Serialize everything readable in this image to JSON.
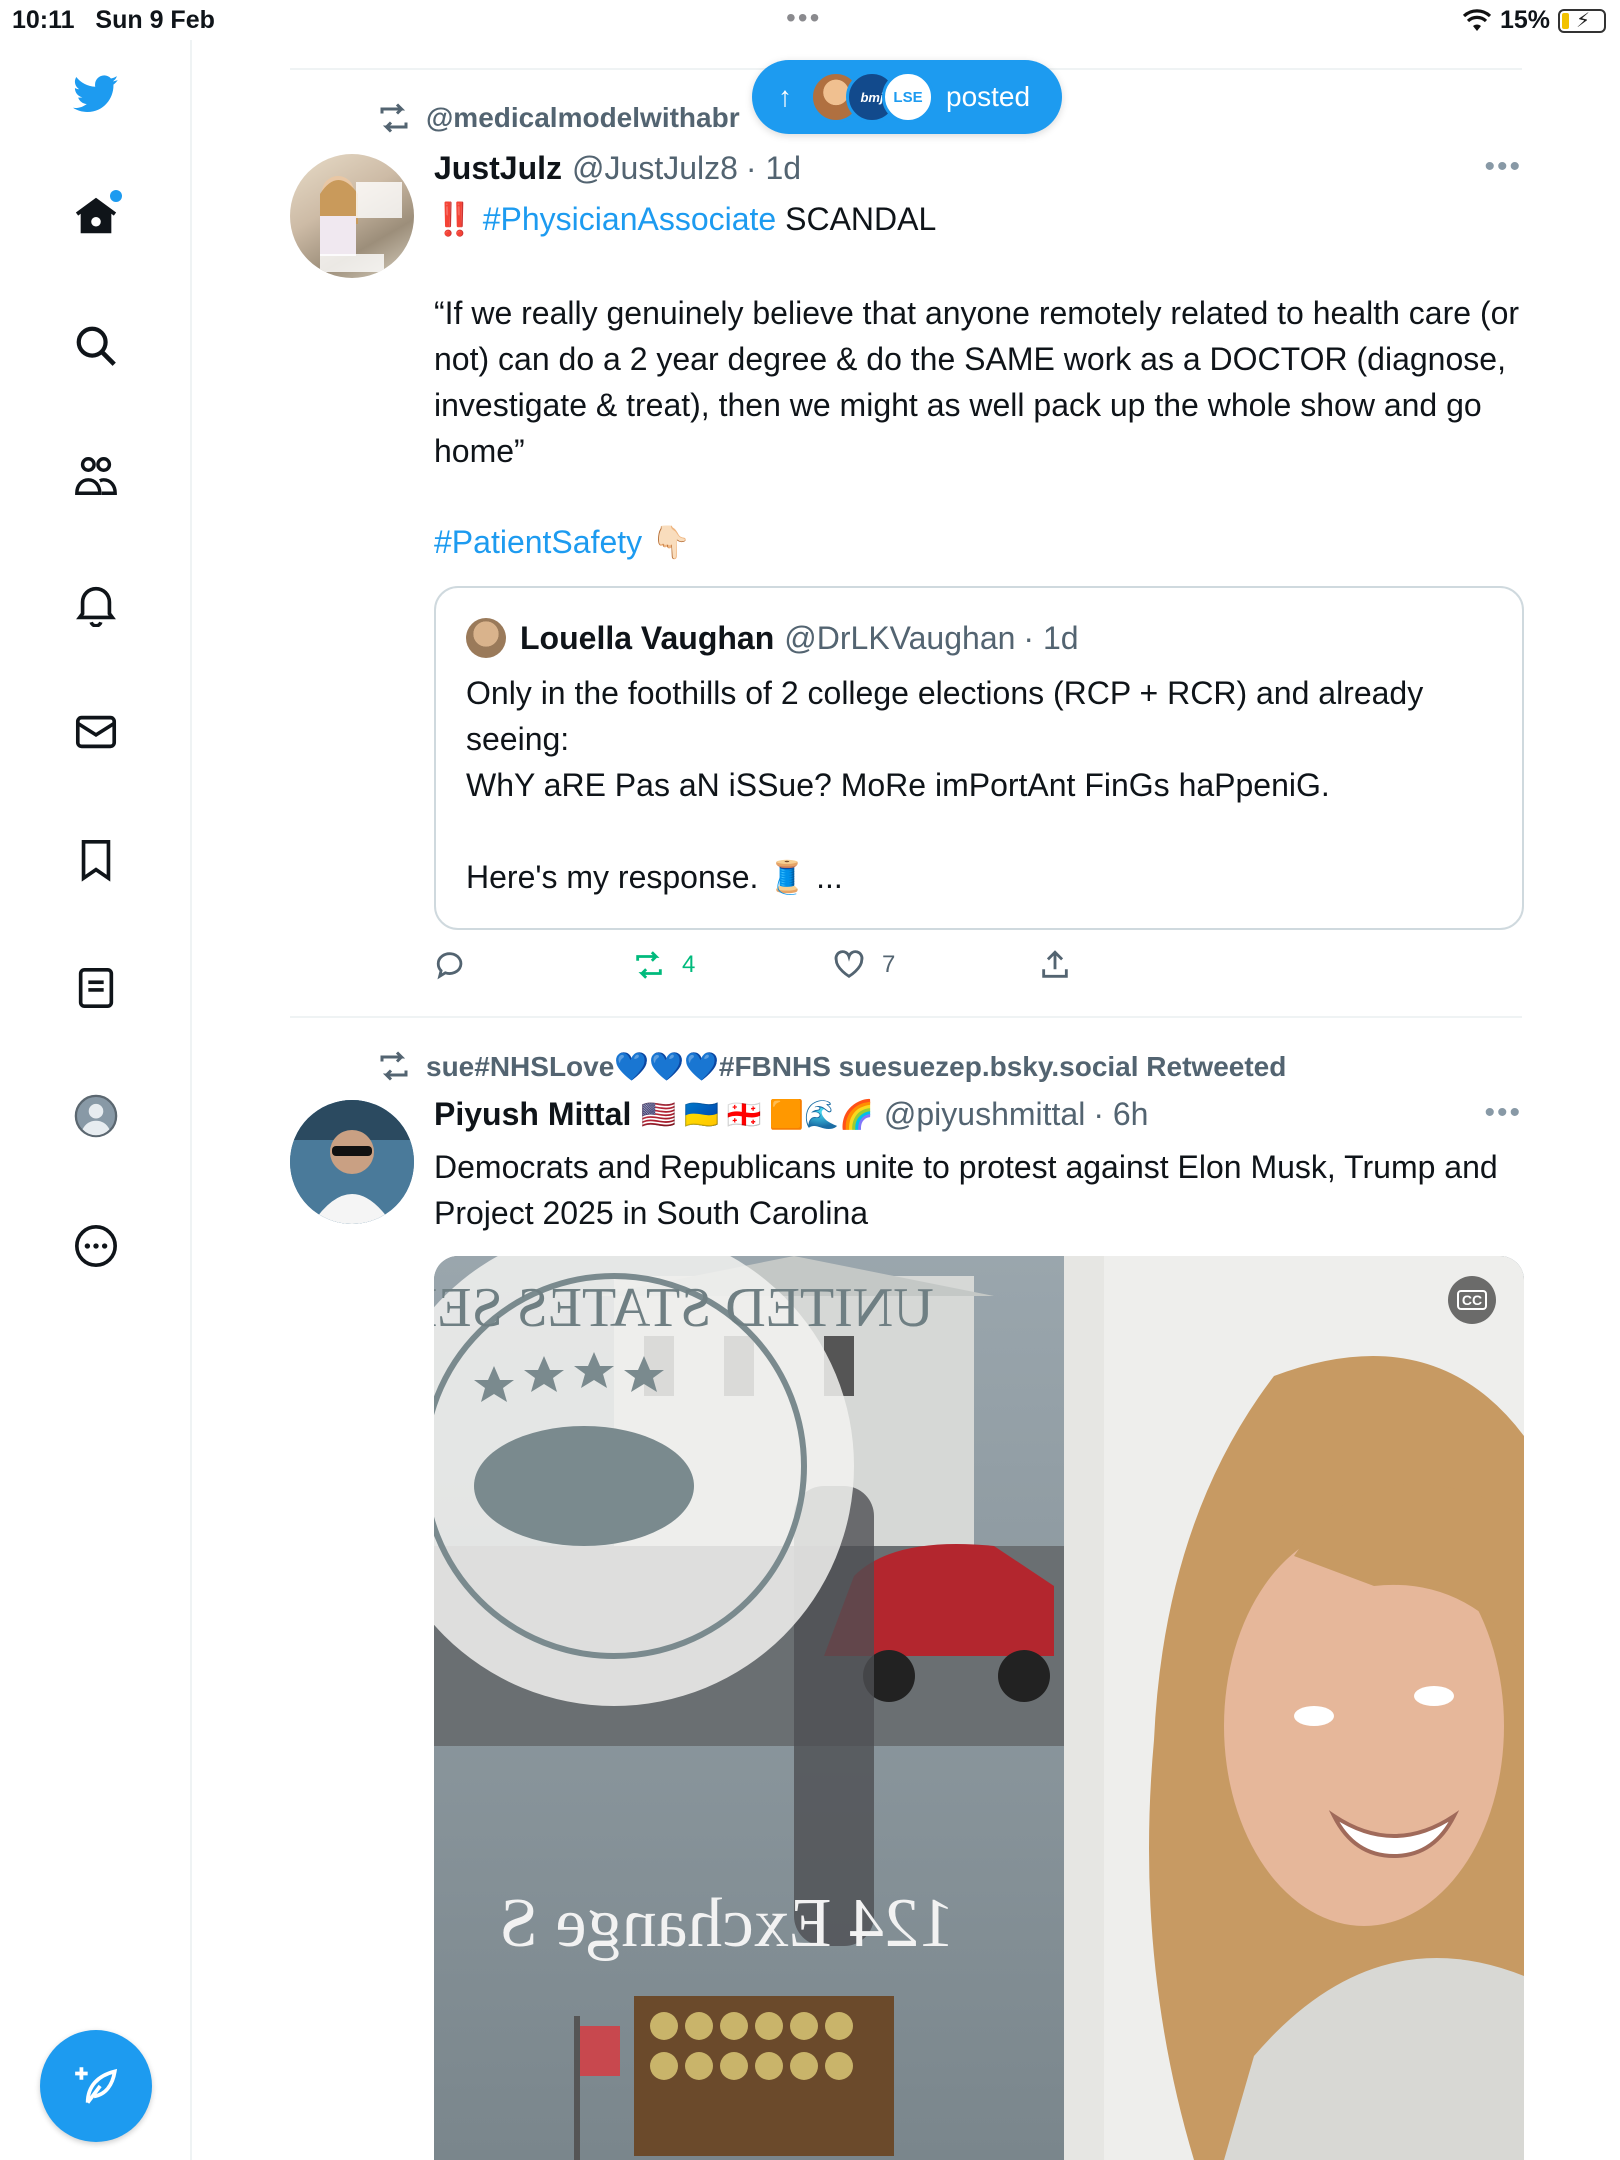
{
  "status_bar": {
    "time": "10:11",
    "date": "Sun 9 Feb",
    "battery": "15%",
    "battery_fraction": 0.15
  },
  "sidebar": {
    "items": [
      {
        "icon": "twitter-logo-icon"
      },
      {
        "icon": "home-icon",
        "has_notification_dot": true
      },
      {
        "icon": "search-icon"
      },
      {
        "icon": "communities-icon"
      },
      {
        "icon": "notifications-bell-icon"
      },
      {
        "icon": "messages-envelope-icon"
      },
      {
        "icon": "bookmark-icon"
      },
      {
        "icon": "lists-icon"
      },
      {
        "icon": "profile-icon"
      },
      {
        "icon": "more-circle-icon"
      }
    ],
    "compose_icon": "compose-feather-icon"
  },
  "new_posts_pill": {
    "arrow": "↑",
    "avatar_labels": [
      "",
      "bmj",
      "LSE"
    ],
    "label": "posted"
  },
  "tweets": [
    {
      "retweeted_by": "@medicalmodelwithabr",
      "author_name": "JustJulz",
      "author_handle": "@JustJulz8",
      "time": "· 1d",
      "text_prefix": "‼️",
      "text_hashtag": "#PhysicianAssociate",
      "text_after": " SCANDAL",
      "body": "“If we really genuinely believe that anyone remotely related to health care (or not) can do a 2 year degree & do the SAME work as a DOCTOR (diagnose, investigate & treat), then we might as well pack up the whole show and go home”",
      "tag_line": "#PatientSafety",
      "tag_emoji": "👇🏻",
      "quote": {
        "author_name": "Louella Vaughan",
        "author_handle": "@DrLKVaughan",
        "time": "· 1d",
        "line1": "Only in the foothills of 2 college elections (RCP + RCR) and already seeing:",
        "line2": "WhY aRE Pas aN iSSue? MoRe imPortAnt FinGs haPpeniG.",
        "line3": "Here's my response. 🧵 ..."
      },
      "actions": {
        "reply": "",
        "retweets": "4",
        "likes": "7",
        "share": ""
      }
    },
    {
      "retweeted_by": "sue#NHSLove💙💙💙#FBNHS suesuezep.bsky.social Retweeted",
      "author_name": "Piyush Mittal",
      "author_flags": "🇺🇸 🇺🇦 🇬🇪 🟧🌊🌈",
      "author_handle": "@piyushmittal",
      "time": "· 6h",
      "body": "Democrats and Republicans unite to protest against Elon Musk, Trump and Project 2025 in South Carolina",
      "media": {
        "cc_label": "CC",
        "window_text": "124 Exchange S",
        "seal_text": "UNITED STATES SENATE"
      }
    }
  ],
  "colors": {
    "accent": "#1d9bf0",
    "retweet_green": "#00ba7c",
    "secondary_text": "#536471",
    "divider": "#eff3f4"
  }
}
